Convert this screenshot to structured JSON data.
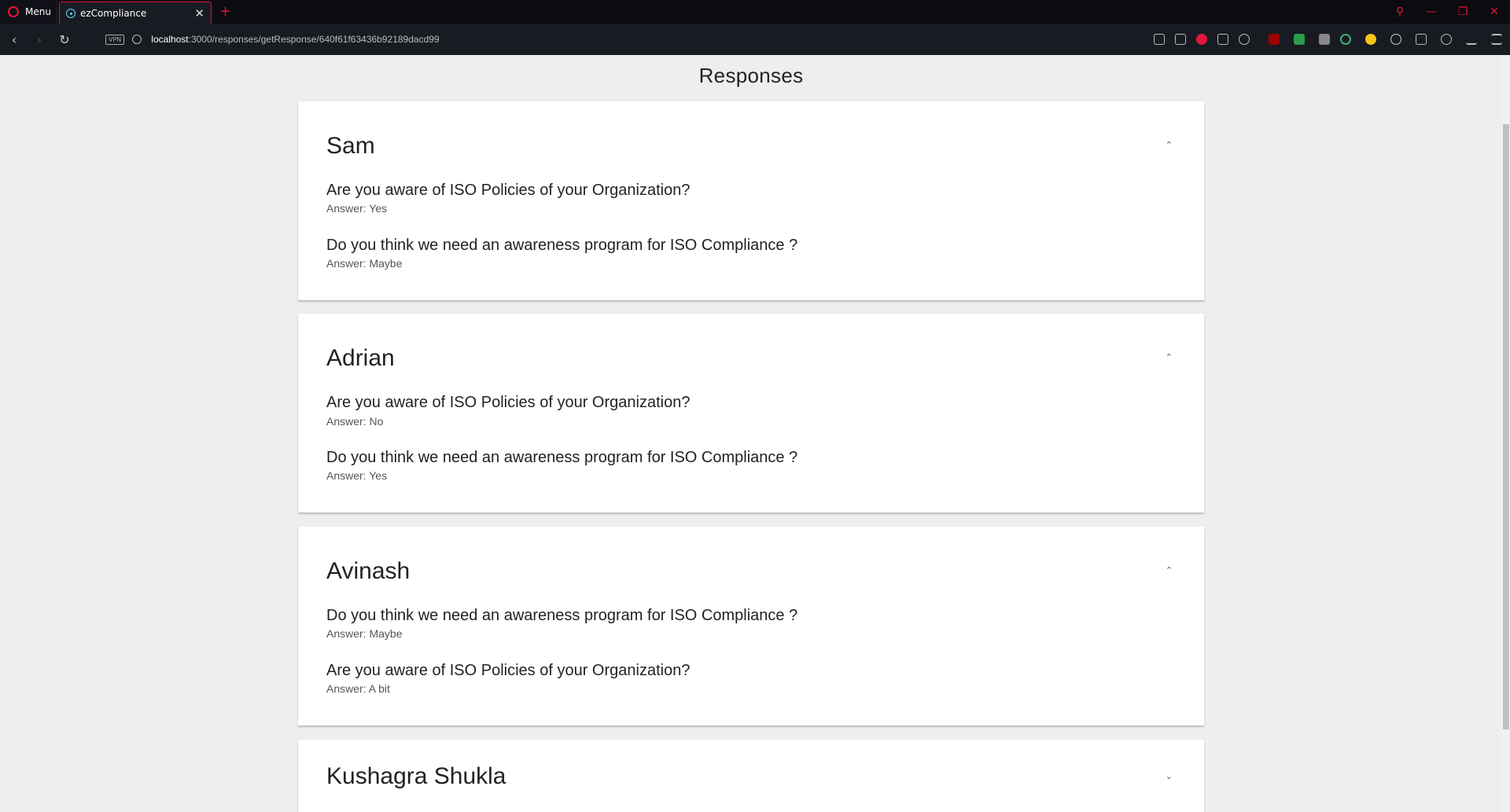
{
  "browser": {
    "menu_label": "Menu",
    "tab_title": "ezCompliance",
    "tab_close": "✕",
    "new_tab": "+",
    "url_host": "localhost",
    "url_path": ":3000/responses/getResponse/640f61f63436b92189dacd99",
    "vpn_label": "VPN"
  },
  "page": {
    "title": "Responses"
  },
  "responses": [
    {
      "name": "Sam",
      "expanded": true,
      "items": [
        {
          "question": "Are you aware of ISO Policies of your Organization?",
          "answer": "Answer: Yes"
        },
        {
          "question": "Do you think we need an awareness program for ISO Compliance ?",
          "answer": "Answer: Maybe"
        }
      ]
    },
    {
      "name": "Adrian",
      "expanded": true,
      "items": [
        {
          "question": "Are you aware of ISO Policies of your Organization?",
          "answer": "Answer: No"
        },
        {
          "question": "Do you think we need an awareness program for ISO Compliance ?",
          "answer": "Answer: Yes"
        }
      ]
    },
    {
      "name": "Avinash",
      "expanded": true,
      "items": [
        {
          "question": "Do you think we need an awareness program for ISO Compliance ?",
          "answer": "Answer: Maybe"
        },
        {
          "question": "Are you aware of ISO Policies of your Organization?",
          "answer": "Answer: A bit"
        }
      ]
    },
    {
      "name": "Kushagra Shukla",
      "expanded": false,
      "items": []
    }
  ],
  "icons": {
    "chevron_up": "⌃",
    "chevron_down": "⌄"
  },
  "colors": {
    "accent": "#e0163b",
    "page_bg": "#eeeeee",
    "card_bg": "#ffffff"
  }
}
